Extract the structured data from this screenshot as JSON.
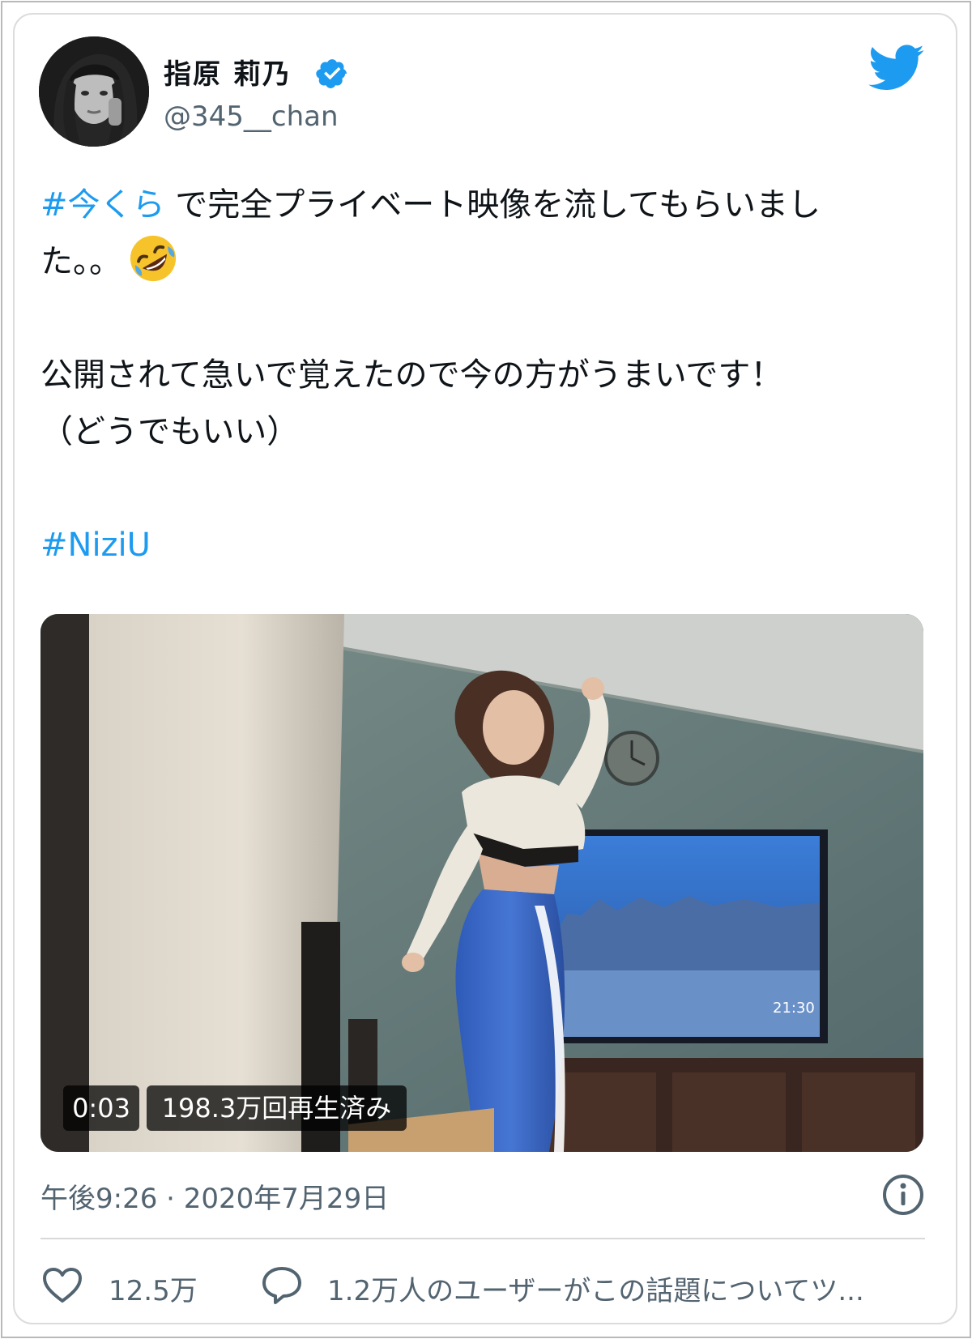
{
  "user": {
    "display_name": "指原 莉乃",
    "handle": "@345__chan",
    "verified": true,
    "avatar_icon": "profile-photo"
  },
  "platform_icon": "twitter-bird-icon",
  "tweet": {
    "hashtag_1": "#今くら",
    "line_1_rest": " で完全プライベート映像を流してもらいまし",
    "line_2": "た。。",
    "emoji": "rolling-on-the-floor-laughing",
    "line_3": "公開されて急いで覚えたので今の方がうまいです！",
    "line_4": "（どうでもいい）",
    "hashtag_2": "#NiziU"
  },
  "video": {
    "elapsed": "0:03",
    "views": "198.3万回再生済み",
    "tv_time": "21:30"
  },
  "meta": {
    "timestamp": "午後9:26 · 2020年7月29日",
    "info_icon": "info-icon"
  },
  "actions": {
    "like_count": "12.5万",
    "conversation": "1.2万人のユーザーがこの話題についてツ..."
  },
  "colors": {
    "link": "#1d9bf0",
    "verified": "#1d9bf0",
    "secondary_text": "#536471",
    "primary_text": "#0f1419"
  }
}
